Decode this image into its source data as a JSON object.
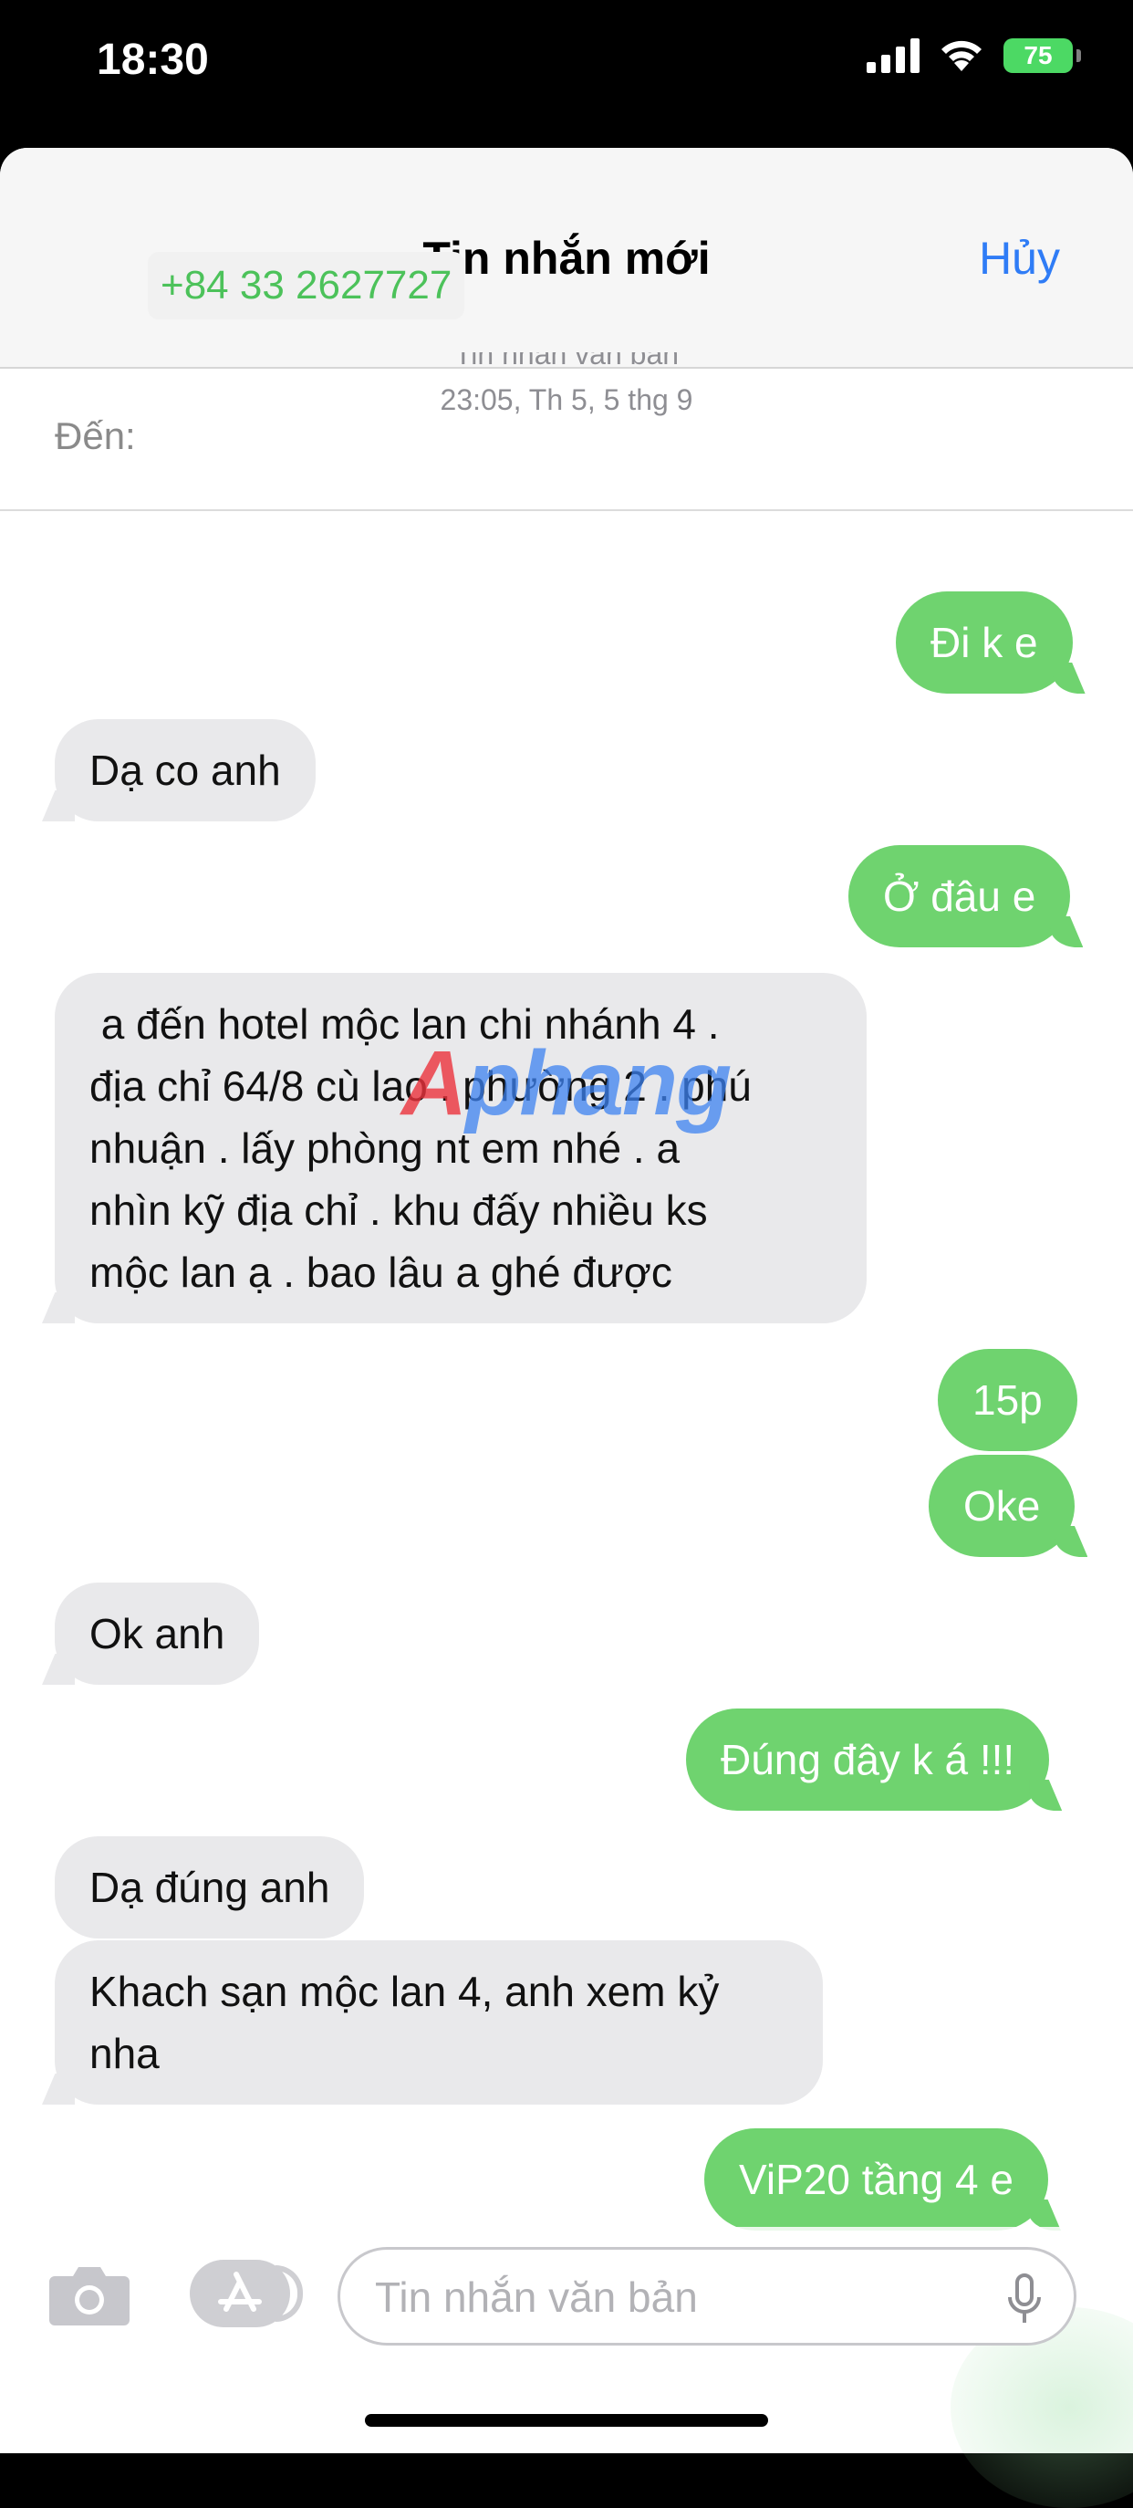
{
  "status_bar": {
    "time": "18:30",
    "battery": "75"
  },
  "header": {
    "title": "Tin nhắn mới",
    "cancel_label": "Hủy"
  },
  "recipient": {
    "label": "Đến:",
    "number": "+84 33 2627727"
  },
  "conversation": {
    "service_label": "Tin nhắn văn bản",
    "timestamp": "23:05, Th 5, 5 thg 9",
    "messages": [
      {
        "direction": "out",
        "text": "Đi k e"
      },
      {
        "direction": "in",
        "text": "Dạ co anh"
      },
      {
        "direction": "out",
        "text": "Ở đâu e"
      },
      {
        "direction": "in",
        "text": " a đến hotel mộc lan chi nhánh 4 .\nđịa chỉ 64/8 cù lao . phường 2 . phú\nnhuận . lấy phòng nt em nhé . a\nnhìn kỹ địa chỉ . khu đấy nhiều ks\nmộc lan ạ . bao lâu a ghé được"
      },
      {
        "direction": "out",
        "text": "15p"
      },
      {
        "direction": "out",
        "text": "Oke"
      },
      {
        "direction": "in",
        "text": "Ok anh"
      },
      {
        "direction": "out",
        "text": "Đúng đây k á !!!"
      },
      {
        "direction": "in",
        "text": "Dạ đúng anh"
      },
      {
        "direction": "in",
        "text": "Khach sạn mộc lan 4, anh xem kỷ\nnha"
      },
      {
        "direction": "out",
        "text": "ViP20 tầng 4 e"
      }
    ]
  },
  "watermark": {
    "text_a": "A",
    "text_rest": "phang"
  },
  "composer": {
    "placeholder": "Tin nhắn văn bản"
  },
  "icons": {
    "signal": "signal-icon",
    "wifi": "wifi-icon",
    "battery": "battery-icon",
    "camera": "camera-icon",
    "apps": "app-store-icon",
    "mic": "microphone-icon"
  },
  "colors": {
    "outgoing_bubble": "#6fd36f",
    "incoming_bubble": "#e9e9eb",
    "link_blue": "#2f7cf6",
    "recipient_green": "#4cc25a"
  }
}
